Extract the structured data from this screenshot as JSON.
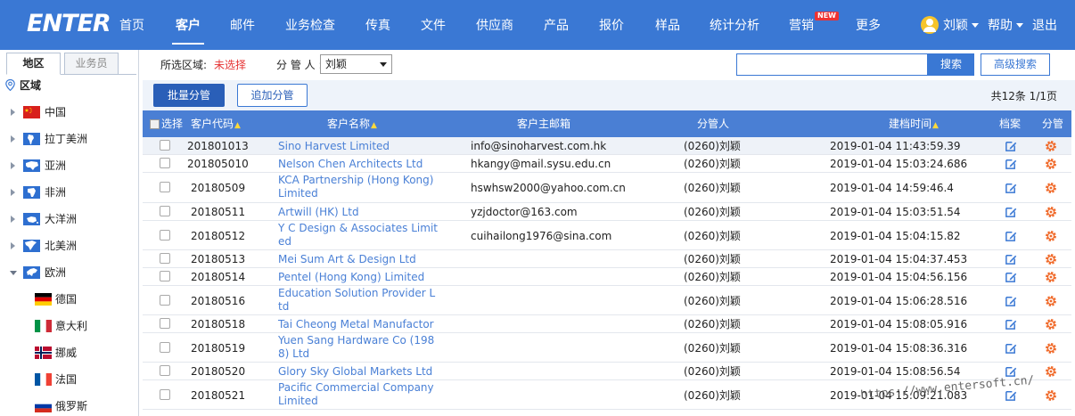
{
  "app": {
    "logo": "ENTER"
  },
  "nav": {
    "items": [
      {
        "label": "首页",
        "active": false
      },
      {
        "label": "客户",
        "active": true
      },
      {
        "label": "邮件",
        "active": false
      },
      {
        "label": "业务检查",
        "active": false
      },
      {
        "label": "传真",
        "active": false
      },
      {
        "label": "文件",
        "active": false
      },
      {
        "label": "供应商",
        "active": false
      },
      {
        "label": "产品",
        "active": false
      },
      {
        "label": "报价",
        "active": false
      },
      {
        "label": "样品",
        "active": false
      },
      {
        "label": "统计分析",
        "active": false
      },
      {
        "label": "营销",
        "active": false
      },
      {
        "label": "更多",
        "active": false
      }
    ],
    "new_badge": "NEW",
    "user": "刘颖",
    "help": "帮助",
    "logout": "退出"
  },
  "sidebar": {
    "tabs": [
      {
        "label": "地区",
        "active": true
      },
      {
        "label": "业务员",
        "active": false
      }
    ],
    "region_heading": "区域",
    "tree": [
      {
        "label": "中国",
        "type": "continent",
        "flag": "china"
      },
      {
        "label": "拉丁美洲",
        "type": "continent",
        "flag": "latam"
      },
      {
        "label": "亚洲",
        "type": "continent",
        "flag": "asia"
      },
      {
        "label": "非洲",
        "type": "continent",
        "flag": "africa"
      },
      {
        "label": "大洋洲",
        "type": "continent",
        "flag": "oceania"
      },
      {
        "label": "北美洲",
        "type": "continent",
        "flag": "namerica"
      },
      {
        "label": "欧洲",
        "type": "continent-open",
        "flag": "europe"
      },
      {
        "label": "德国",
        "type": "country",
        "flag": "germany"
      },
      {
        "label": "意大利",
        "type": "country",
        "flag": "italy"
      },
      {
        "label": "挪威",
        "type": "country",
        "flag": "norway"
      },
      {
        "label": "法国",
        "type": "country",
        "flag": "france"
      },
      {
        "label": "俄罗斯",
        "type": "country",
        "flag": "russia"
      }
    ]
  },
  "filters": {
    "region_label": "所选区域:",
    "region_value": "未选择",
    "manager_label": "分 管 人 :",
    "manager_value": "刘颖"
  },
  "search": {
    "button": "搜索",
    "advanced": "高级搜索"
  },
  "actions": {
    "batch": "批量分管",
    "add": "追加分管",
    "pager": "共12条 1/1页"
  },
  "table": {
    "headers": {
      "select": "选择",
      "code": "客户代码",
      "name": "客户名称",
      "email": "客户主邮箱",
      "manager": "分管人",
      "created": "建档时间",
      "archive": "档案",
      "assign": "分管"
    },
    "rows": [
      {
        "code": "201801013",
        "name": "Sino Harvest Limited",
        "email": "info@sinoharvest.com.hk",
        "manager": "(0260)刘颖",
        "created": "2019-01-04 11:43:59.39"
      },
      {
        "code": "201805010",
        "name": "Nelson Chen Architects Ltd",
        "email": "hkangy@mail.sysu.edu.cn",
        "manager": "(0260)刘颖",
        "created": "2019-01-04 15:03:24.686"
      },
      {
        "code": "20180509",
        "name": "KCA Partnership (Hong Kong) Limited",
        "email": "hswhsw2000@yahoo.com.cn",
        "manager": "(0260)刘颖",
        "created": "2019-01-04 14:59:46.4"
      },
      {
        "code": "20180511",
        "name": "Artwill (HK) Ltd",
        "email": "yzjdoctor@163.com",
        "manager": "(0260)刘颖",
        "created": "2019-01-04 15:03:51.54"
      },
      {
        "code": "20180512",
        "name": "Y C Design & Associates Limited",
        "email": "cuihailong1976@sina.com",
        "manager": "(0260)刘颖",
        "created": "2019-01-04 15:04:15.82"
      },
      {
        "code": "20180513",
        "name": "Mei Sum Art & Design Ltd",
        "email": "",
        "manager": "(0260)刘颖",
        "created": "2019-01-04 15:04:37.453"
      },
      {
        "code": "20180514",
        "name": "Pentel (Hong Kong) Limited",
        "email": "",
        "manager": "(0260)刘颖",
        "created": "2019-01-04 15:04:56.156"
      },
      {
        "code": "20180516",
        "name": "Education Solution Provider Ltd",
        "email": "",
        "manager": "(0260)刘颖",
        "created": "2019-01-04 15:06:28.516"
      },
      {
        "code": "20180518",
        "name": "Tai Cheong Metal Manufactory",
        "email": "",
        "manager": "(0260)刘颖",
        "created": "2019-01-04 15:08:05.916"
      },
      {
        "code": "20180519",
        "name": "Yuen Sang Hardware Co (1988) Ltd",
        "email": "",
        "manager": "(0260)刘颖",
        "created": "2019-01-04 15:08:36.316"
      },
      {
        "code": "20180520",
        "name": "Glory Sky Global Markets Ltd",
        "email": "",
        "manager": "(0260)刘颖",
        "created": "2019-01-04 15:08:56.54"
      },
      {
        "code": "20180521",
        "name": "Pacific Commercial Company Limited",
        "email": "",
        "manager": "(0260)刘颖",
        "created": "2019-01-04 15:09:21.083"
      }
    ]
  },
  "watermark": "https://www.entersoft.cn/",
  "colors": {
    "nav": "#3a78d4",
    "header": "#4a7fd4",
    "link": "#4a80d6",
    "alert": "#e53333",
    "gear": "#f06a2a"
  }
}
